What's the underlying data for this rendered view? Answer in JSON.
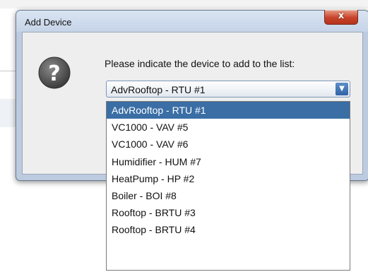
{
  "dialog": {
    "title": "Add Device",
    "close_glyph": "x",
    "prompt": "Please indicate the device to add to the list:",
    "icon": "question-icon",
    "selected_device": "AdvRooftop - RTU #1",
    "dropdown_arrow": "▼"
  },
  "devices": [
    {
      "label": "AdvRooftop - RTU #1",
      "selected": true
    },
    {
      "label": "VC1000 - VAV #5"
    },
    {
      "label": "VC1000 - VAV #6"
    },
    {
      "label": "Humidifier - HUM #7"
    },
    {
      "label": "HeatPump - HP #2"
    },
    {
      "label": "Boiler - BOI #8"
    },
    {
      "label": "Rooftop - BRTU #3"
    },
    {
      "label": "Rooftop - BRTU #4"
    }
  ],
  "colors": {
    "selection": "#3a6ea5",
    "close_button": "#c7432a",
    "dialog_frame": "#bccbe0"
  }
}
